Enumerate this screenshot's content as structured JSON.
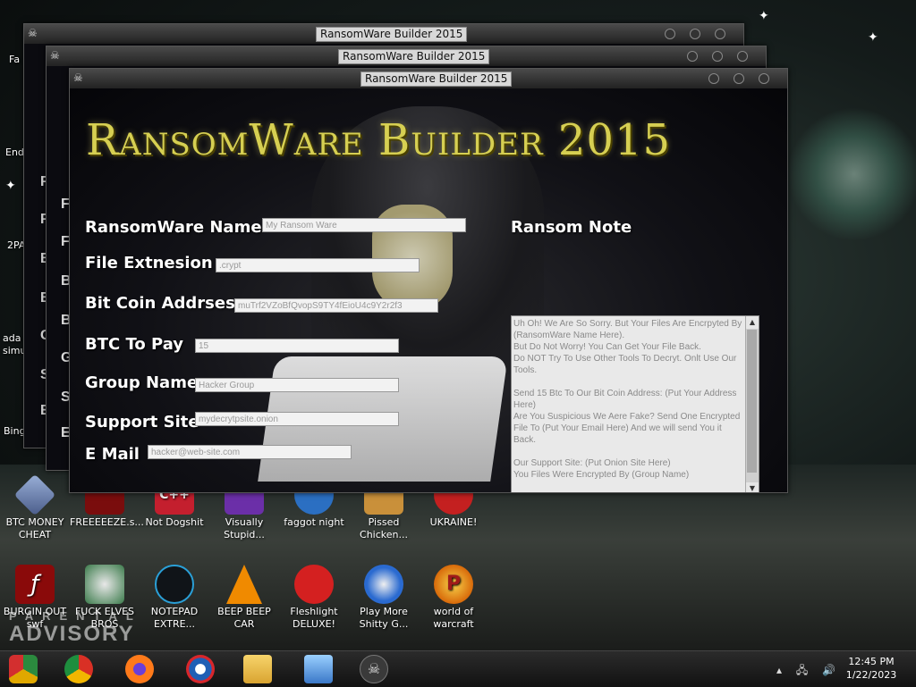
{
  "desktop": {
    "edge_labels": [
      "Fa",
      "End",
      "2PA",
      "ada",
      "simu",
      "Bing"
    ],
    "row1": [
      {
        "label": "BTC MONEY CHEAT",
        "icon": "diamond-icon"
      },
      {
        "label": "FREEEEEZE.s...",
        "icon": "flash-icon"
      },
      {
        "label": "Not Dogshit",
        "icon": "cpp-icon"
      },
      {
        "label": "Visually Stupid...",
        "icon": "visual-studio-icon"
      },
      {
        "label": "faggot night",
        "icon": "game-icon"
      },
      {
        "label": "Pissed Chicken...",
        "icon": "seasons-icon"
      },
      {
        "label": "UKRAINE!",
        "icon": "antivirus-icon"
      }
    ],
    "row2": [
      {
        "label": "BURGIN OUT swf",
        "icon": "flash-player-icon"
      },
      {
        "label": "FUCK ELVES BROS",
        "icon": "elves-icon"
      },
      {
        "label": "NOTEPAD EXTRE...",
        "icon": "notepad-icon"
      },
      {
        "label": "BEEP BEEP CAR",
        "icon": "vlc-icon"
      },
      {
        "label": "Fleshlight DELUXE!",
        "icon": "red-fuzzy-icon"
      },
      {
        "label": "Play More Shitty G...",
        "icon": "popcap-icon"
      },
      {
        "label": "world of warcraft",
        "icon": "p-icon"
      }
    ],
    "advisory": "PARENTAL ADVISORY"
  },
  "windows": {
    "back2_title": "RansomWare Builder 2015",
    "back1_title": "RansomWare Builder 2015",
    "main_title": "RansomWare Builder 2015"
  },
  "app": {
    "logo": "RansomWare Builder 2015",
    "fields": {
      "name_label": "RansomWare Name",
      "name_value": "My Ransom Ware",
      "ext_label": "File Extnesion",
      "ext_value": ".crypt",
      "btc_addr_label": "Bit Coin Addrses",
      "btc_addr_value": "muTrf2VZoBfQvopS9TY4fEioU4c9Y2r2f3",
      "btc_pay_label": "BTC To Pay",
      "btc_pay_value": "15",
      "group_label": "Group Name",
      "group_value": "Hacker Group",
      "site_label": "Support Site",
      "site_value": "mydecrytpsite.onion",
      "email_label": "E Mail",
      "email_value": "hacker@web-site.com"
    },
    "note_label": "Ransom Note",
    "note_text": "Uh Oh! We Are So Sorry. But Your Files Are Encrpyted By (RansomWare Name Here).\nBut Do Not Worry! You Can Get Your File Back.\nDo NOT Try To Use Other Tools To Decryt. Onlt Use Our Tools.\n\nSend 15 Btc To Our Bit Coin Address: (Put Your Address Here)\nAre You Suspicious We Aere Fake? Send One Encrypted File To (Put Your Email Here) And we will send You it Back.\n\nOur Support Site: (Put Onion Site Here)\nYou Files Were Encrypted By (Group Name)"
  },
  "taskbar": {
    "time": "12:45 PM",
    "date": "1/22/2023"
  }
}
